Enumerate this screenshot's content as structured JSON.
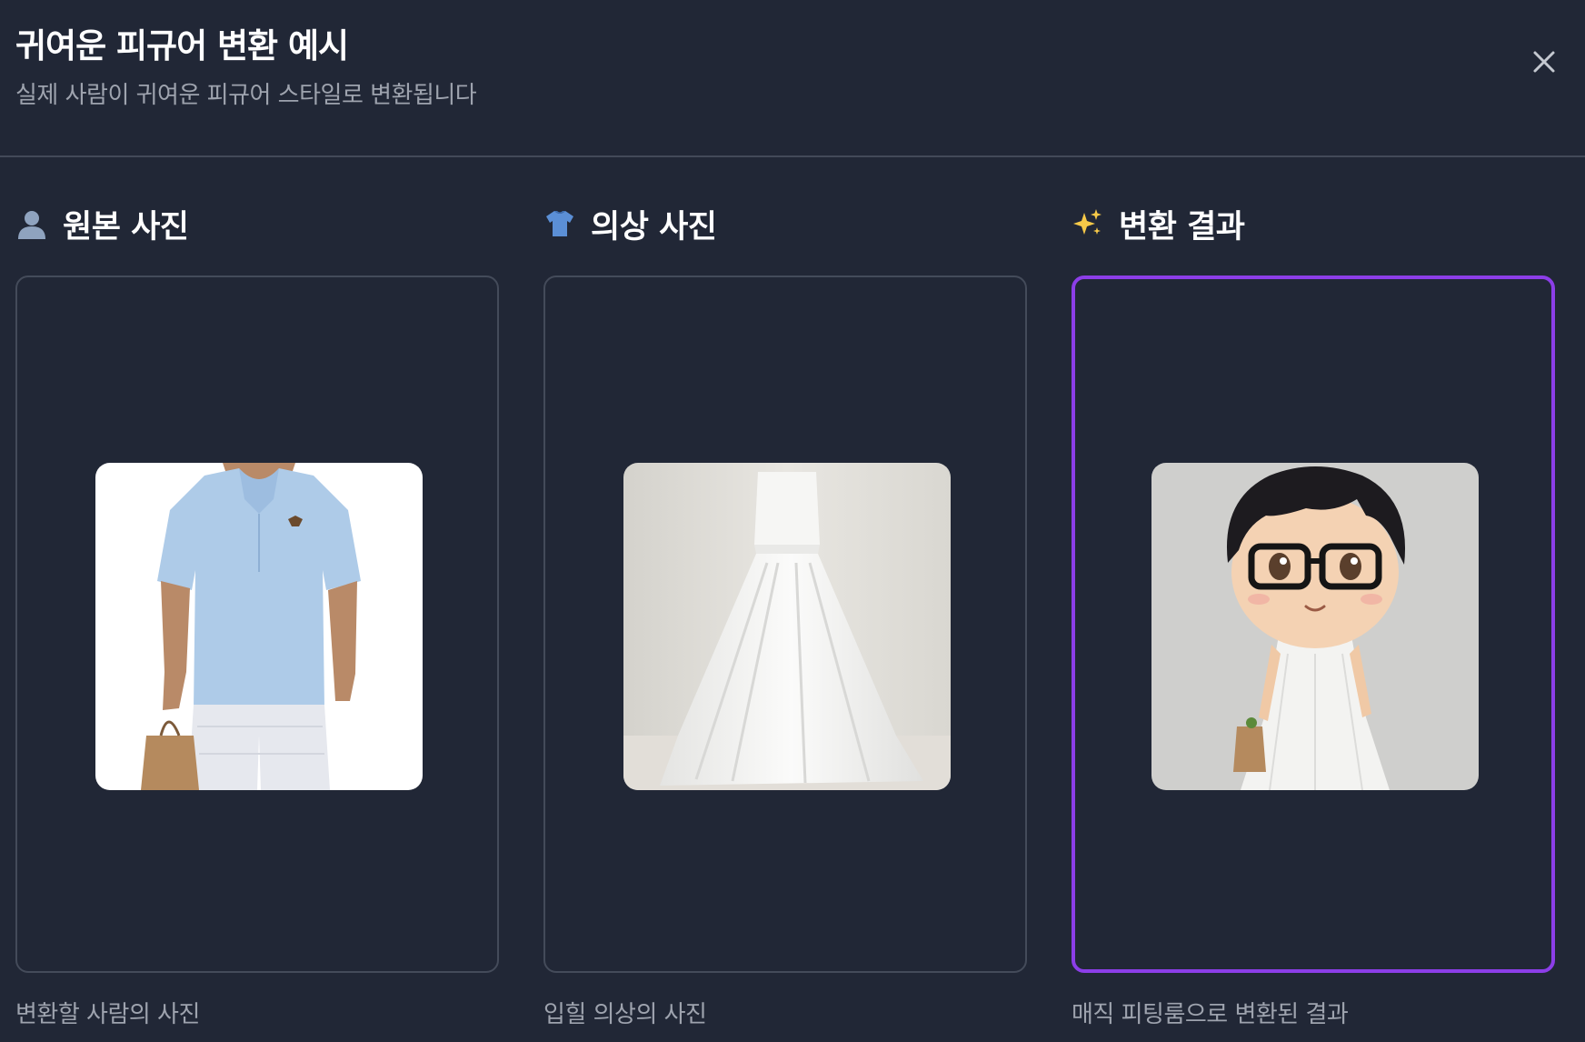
{
  "modal": {
    "title": "귀여운 피규어 변환 예시",
    "subtitle": "실제 사람이 귀여운 피규어 스타일로 변환됩니다",
    "close_icon": "close-icon"
  },
  "columns": [
    {
      "icon": "person-silhouette-icon",
      "heading": "원본 사진",
      "image": "man-in-light-blue-polo-shirt-with-paper-bag",
      "caption": "변환할 사람의 사진",
      "selected": false
    },
    {
      "icon": "shirt-icon",
      "heading": "의상 사진",
      "image": "white-satin-wedding-dress-on-mannequin",
      "caption": "입힐 의상의 사진",
      "selected": false
    },
    {
      "icon": "sparkles-icon",
      "heading": "변환 결과",
      "image": "chibi-figure-with-glasses-in-white-dress",
      "caption": "매직 피팅룸으로 변환된 결과",
      "selected": true
    }
  ],
  "colors": {
    "background": "#212736",
    "divider": "#434a59",
    "frame_border": "#444b5a",
    "selected_border": "#8c3ee8",
    "title_text": "#ffffff",
    "muted_text": "#9ea3ae"
  }
}
